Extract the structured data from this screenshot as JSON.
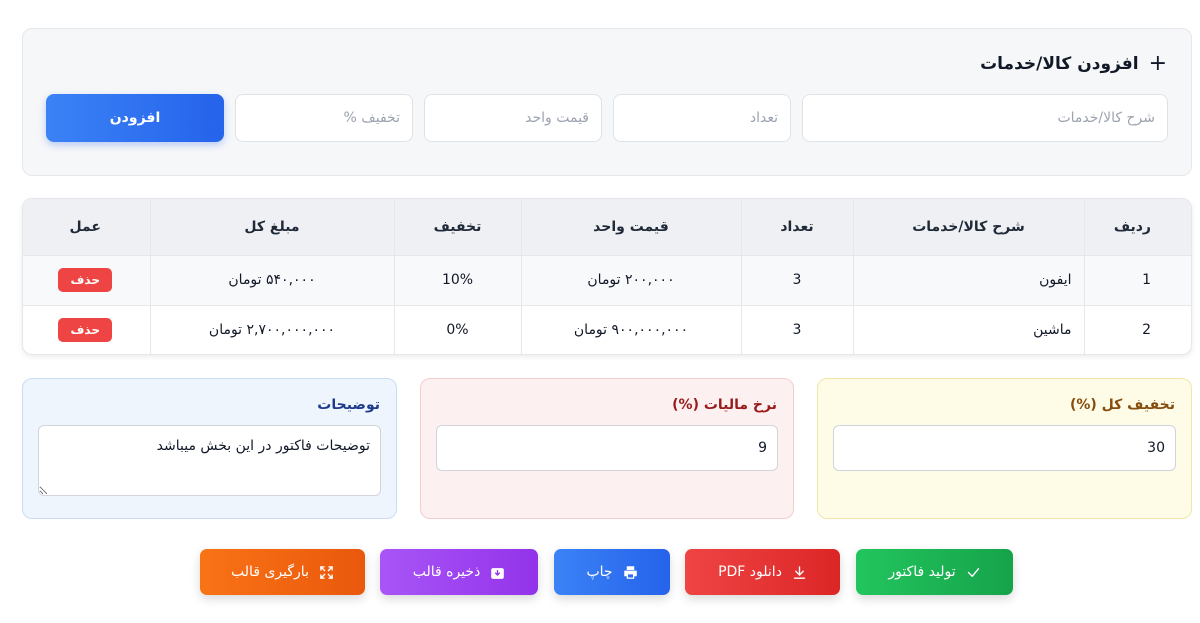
{
  "add_section": {
    "title": "افزودن کالا/خدمات",
    "desc_placeholder": "شرح کالا/خدمات",
    "qty_placeholder": "تعداد",
    "price_placeholder": "قیمت واحد",
    "discount_placeholder": "تخفیف %",
    "add_label": "افزودن"
  },
  "table": {
    "headers": {
      "row": "ردیف",
      "desc": "شرح کالا/خدمات",
      "qty": "تعداد",
      "price": "قیمت واحد",
      "discount": "تخفیف",
      "total": "مبلغ کل",
      "action": "عمل"
    },
    "rows": [
      {
        "row": "1",
        "desc": "ایفون",
        "qty": "3",
        "price": "۲۰۰,۰۰۰ تومان",
        "discount": "10%",
        "total": "۵۴۰,۰۰۰ تومان",
        "action": "حذف"
      },
      {
        "row": "2",
        "desc": "ماشین",
        "qty": "3",
        "price": "۹۰۰,۰۰۰,۰۰۰ تومان",
        "discount": "0%",
        "total": "۲,۷۰۰,۰۰۰,۰۰۰ تومان",
        "action": "حذف"
      }
    ]
  },
  "summary": {
    "notes_label": "توضیحات",
    "notes_value": "توضیحات فاکتور در این بخش میباشد",
    "tax_label": "نرخ مالیات (%)",
    "tax_value": "9",
    "discount_label": "تخفیف کل (%)",
    "discount_value": "30"
  },
  "actions": {
    "generate": "تولید فاکتور",
    "pdf": "دانلود PDF",
    "print": "چاپ",
    "save_template": "ذخیره قالب",
    "load_template": "بارگیری قالب"
  },
  "icons": {
    "add": "plus-icon",
    "generate": "check-icon",
    "pdf": "download-icon",
    "print": "printer-icon",
    "save": "save-download-icon",
    "load": "expand-icon"
  },
  "colors": {
    "primary": "#2563eb",
    "danger": "#ef4444",
    "success": "#16a34a",
    "purple": "#9333ea",
    "orange": "#ea580c"
  }
}
